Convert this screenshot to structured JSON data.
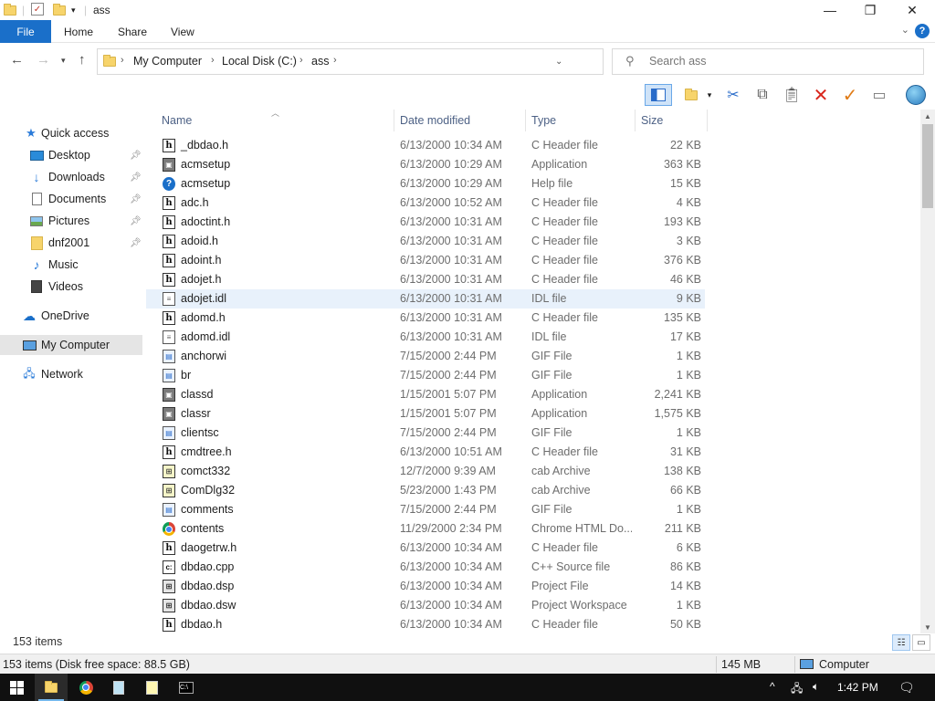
{
  "title": {
    "folder": "ass"
  },
  "window_controls": {
    "minimize": "—",
    "maximize": "❐",
    "close": "✕"
  },
  "ribbon": {
    "file_tab": "File",
    "tabs": [
      "Home",
      "Share",
      "View"
    ]
  },
  "address": {
    "crumbs": [
      "My Computer",
      "Local Disk (C:)",
      "ass"
    ]
  },
  "search": {
    "placeholder": "Search ass"
  },
  "nav": {
    "quick_access": "Quick access",
    "items": [
      "Desktop",
      "Downloads",
      "Documents",
      "Pictures",
      "dnf2001",
      "Music",
      "Videos"
    ],
    "onedrive": "OneDrive",
    "my_computer": "My Computer",
    "network": "Network"
  },
  "columns": {
    "name": "Name",
    "date": "Date modified",
    "type": "Type",
    "size": "Size"
  },
  "files": [
    {
      "name": "_dbdao.h",
      "date": "6/13/2000 10:34 AM",
      "type": "C Header file",
      "size": "22 KB",
      "icon": "h"
    },
    {
      "name": "acmsetup",
      "date": "6/13/2000 10:29 AM",
      "type": "Application",
      "size": "363 KB",
      "icon": "app"
    },
    {
      "name": "acmsetup",
      "date": "6/13/2000 10:29 AM",
      "type": "Help file",
      "size": "15 KB",
      "icon": "help"
    },
    {
      "name": "adc.h",
      "date": "6/13/2000 10:52 AM",
      "type": "C Header file",
      "size": "4 KB",
      "icon": "h"
    },
    {
      "name": "adoctint.h",
      "date": "6/13/2000 10:31 AM",
      "type": "C Header file",
      "size": "193 KB",
      "icon": "h"
    },
    {
      "name": "adoid.h",
      "date": "6/13/2000 10:31 AM",
      "type": "C Header file",
      "size": "3 KB",
      "icon": "h"
    },
    {
      "name": "adoint.h",
      "date": "6/13/2000 10:31 AM",
      "type": "C Header file",
      "size": "376 KB",
      "icon": "h"
    },
    {
      "name": "adojet.h",
      "date": "6/13/2000 10:31 AM",
      "type": "C Header file",
      "size": "46 KB",
      "icon": "h"
    },
    {
      "name": "adojet.idl",
      "date": "6/13/2000 10:31 AM",
      "type": "IDL file",
      "size": "9 KB",
      "icon": "idl"
    },
    {
      "name": "adomd.h",
      "date": "6/13/2000 10:31 AM",
      "type": "C Header file",
      "size": "135 KB",
      "icon": "h"
    },
    {
      "name": "adomd.idl",
      "date": "6/13/2000 10:31 AM",
      "type": "IDL file",
      "size": "17 KB",
      "icon": "idl"
    },
    {
      "name": "anchorwi",
      "date": "7/15/2000 2:44 PM",
      "type": "GIF File",
      "size": "1 KB",
      "icon": "gif"
    },
    {
      "name": "br",
      "date": "7/15/2000 2:44 PM",
      "type": "GIF File",
      "size": "1 KB",
      "icon": "gif"
    },
    {
      "name": "classd",
      "date": "1/15/2001 5:07 PM",
      "type": "Application",
      "size": "2,241 KB",
      "icon": "app"
    },
    {
      "name": "classr",
      "date": "1/15/2001 5:07 PM",
      "type": "Application",
      "size": "1,575 KB",
      "icon": "app"
    },
    {
      "name": "clientsc",
      "date": "7/15/2000 2:44 PM",
      "type": "GIF File",
      "size": "1 KB",
      "icon": "gif"
    },
    {
      "name": "cmdtree.h",
      "date": "6/13/2000 10:51 AM",
      "type": "C Header file",
      "size": "31 KB",
      "icon": "h"
    },
    {
      "name": "comct332",
      "date": "12/7/2000 9:39 AM",
      "type": "cab Archive",
      "size": "138 KB",
      "icon": "cab"
    },
    {
      "name": "ComDlg32",
      "date": "5/23/2000 1:43 PM",
      "type": "cab Archive",
      "size": "66 KB",
      "icon": "cab"
    },
    {
      "name": "comments",
      "date": "7/15/2000 2:44 PM",
      "type": "GIF File",
      "size": "1 KB",
      "icon": "gif"
    },
    {
      "name": "contents",
      "date": "11/29/2000 2:34 PM",
      "type": "Chrome HTML Do...",
      "size": "211 KB",
      "icon": "chrome"
    },
    {
      "name": "daogetrw.h",
      "date": "6/13/2000 10:34 AM",
      "type": "C Header file",
      "size": "6 KB",
      "icon": "h"
    },
    {
      "name": "dbdao.cpp",
      "date": "6/13/2000 10:34 AM",
      "type": "C++ Source file",
      "size": "86 KB",
      "icon": "cpp"
    },
    {
      "name": "dbdao.dsp",
      "date": "6/13/2000 10:34 AM",
      "type": "Project File",
      "size": "14 KB",
      "icon": "proj"
    },
    {
      "name": "dbdao.dsw",
      "date": "6/13/2000 10:34 AM",
      "type": "Project Workspace",
      "size": "1 KB",
      "icon": "proj"
    },
    {
      "name": "dbdao.h",
      "date": "6/13/2000 10:34 AM",
      "type": "C Header file",
      "size": "50 KB",
      "icon": "h"
    }
  ],
  "count_bar": {
    "items": "153 items"
  },
  "status": {
    "summary": "153 items (Disk free space: 88.5 GB)",
    "size": "145 MB",
    "location": "Computer"
  },
  "taskbar": {
    "time": "1:42 PM"
  }
}
